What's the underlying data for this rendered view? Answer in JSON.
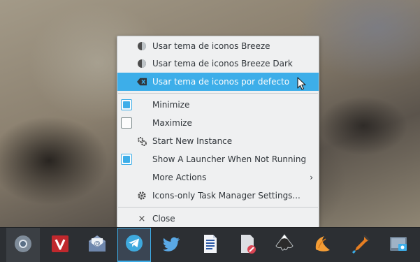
{
  "menu": {
    "items": [
      {
        "label": "Usar tema de iconos Breeze",
        "icon": "theme-icon",
        "highlighted": false
      },
      {
        "label": "Usar tema de iconos Breeze Dark",
        "icon": "theme-icon",
        "highlighted": false
      },
      {
        "label": "Usar tema de iconos por defecto",
        "icon": "clear-icon",
        "highlighted": true
      },
      {
        "label": "Minimize",
        "checked": true
      },
      {
        "label": "Maximize",
        "checked": false
      },
      {
        "label": "Start New Instance",
        "icon": "gears-icon"
      },
      {
        "label": "Show A Launcher When Not Running",
        "checked": true
      },
      {
        "label": "More Actions",
        "submenu": true,
        "arrow": "›"
      },
      {
        "label": "Icons-only Task Manager Settings...",
        "icon": "gear-icon"
      },
      {
        "label": "Close",
        "icon": "close-icon",
        "glyph": "×"
      }
    ]
  },
  "taskbar": {
    "apps": [
      {
        "name": "chromium",
        "icon": "chromium-icon"
      },
      {
        "name": "vivaldi",
        "icon": "vivaldi-icon"
      },
      {
        "name": "mail",
        "icon": "mail-icon"
      },
      {
        "name": "telegram",
        "icon": "telegram-icon",
        "active": true
      },
      {
        "name": "twitter",
        "icon": "twitter-icon"
      },
      {
        "name": "writer",
        "icon": "document-icon"
      },
      {
        "name": "editor",
        "icon": "document-edit-icon"
      },
      {
        "name": "inkscape",
        "icon": "inkscape-icon"
      },
      {
        "name": "peach",
        "icon": "peach-icon"
      },
      {
        "name": "color-picker",
        "icon": "color-picker-icon"
      },
      {
        "name": "screenshot",
        "icon": "screenshot-icon"
      }
    ]
  },
  "colors": {
    "accent": "#3daee9",
    "menu_bg": "#eff0f1",
    "taskbar_bg": "#2c2f33"
  }
}
